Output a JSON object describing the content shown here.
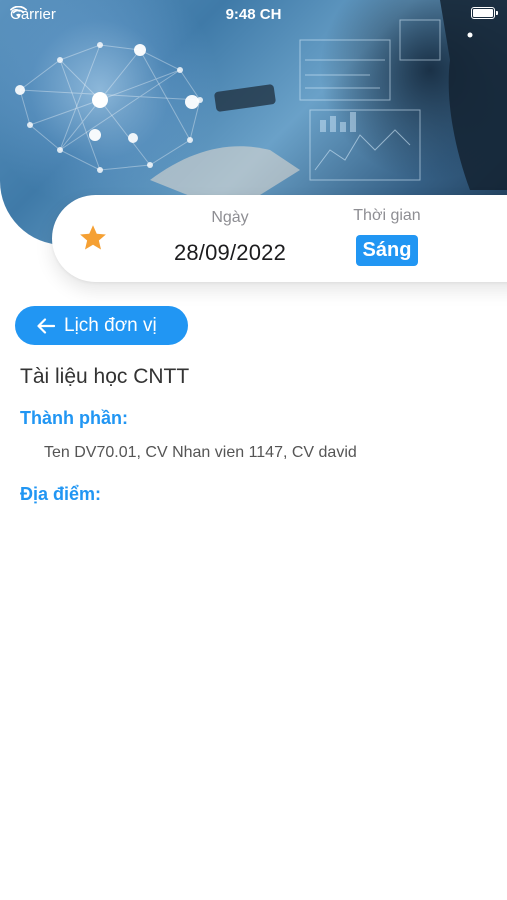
{
  "status_bar": {
    "carrier": "Carrier",
    "time": "9:48 CH",
    "wifi_icon": "wifi-icon",
    "battery_icon": "battery-icon"
  },
  "header": {
    "image": "technology-hero-image"
  },
  "info_card": {
    "star_icon": "star-icon",
    "star_color": "#f5a033",
    "date_label": "Ngày",
    "date_value": "28/09/2022",
    "time_label": "Thời gian",
    "time_value": "Sáng"
  },
  "back_button": {
    "icon": "arrow-left-icon",
    "label": "Lịch đơn vị"
  },
  "event": {
    "title": "Tài liệu học CNTT",
    "participants_label": "Thành phần:",
    "participants_value": "Ten DV70.01, CV Nhan vien 1147, CV david",
    "location_label": "Địa điểm:"
  },
  "colors": {
    "accent": "#2196f3",
    "label_gray": "#8e8e93",
    "text_dark": "#1c1c1e"
  }
}
